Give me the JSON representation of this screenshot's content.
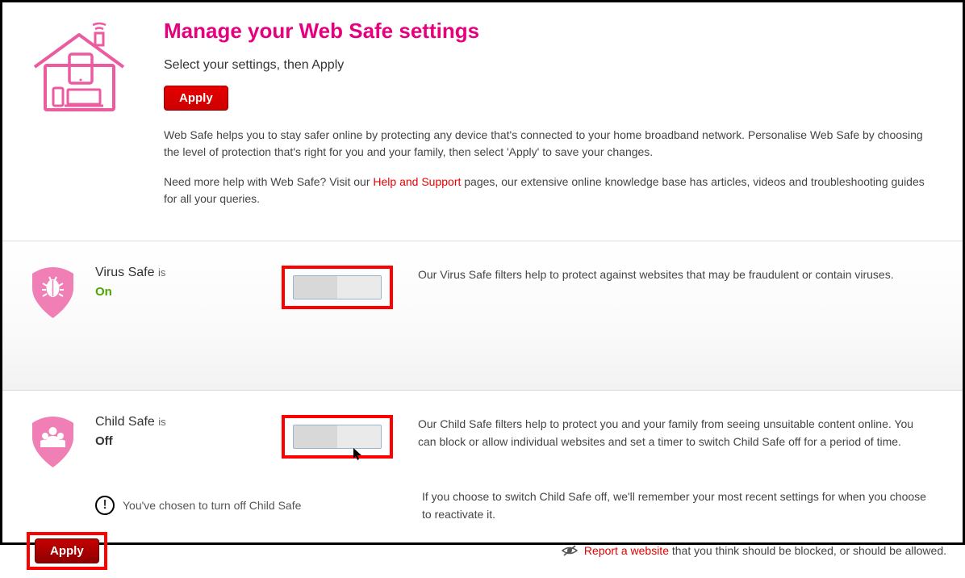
{
  "header": {
    "title": "Manage your Web Safe settings",
    "subtitle": "Select your settings, then Apply",
    "apply_label": "Apply",
    "description1": "Web Safe helps you to stay safer online by protecting any device that's connected to your home broadband network. Personalise Web Safe by choosing the level of protection that's right for you and your family, then select 'Apply' to save your changes.",
    "help_prefix": "Need more help with Web Safe? Visit our ",
    "help_link": "Help and Support",
    "help_suffix": " pages, our extensive online knowledge base has articles, videos and troubleshooting guides for all your queries."
  },
  "virus_safe": {
    "name": "Virus Safe",
    "is_text": "is",
    "status": "On",
    "description": "Our Virus Safe filters help to protect against websites that may be fraudulent or contain viruses."
  },
  "child_safe": {
    "name": "Child Safe",
    "is_text": "is",
    "status": "Off",
    "description1": "Our Child Safe filters help to protect you and your family from seeing unsuitable content online. You can block or allow individual websites and set a timer to switch Child Safe off for a period of time.",
    "warning": "You've chosen to turn off Child Safe",
    "description2": "If you choose to switch Child Safe off, we'll remember your most recent settings for when you choose to reactivate it."
  },
  "footer": {
    "apply_label": "Apply",
    "report_link": "Report a website",
    "report_suffix": " that you think should be blocked, or should be allowed."
  }
}
